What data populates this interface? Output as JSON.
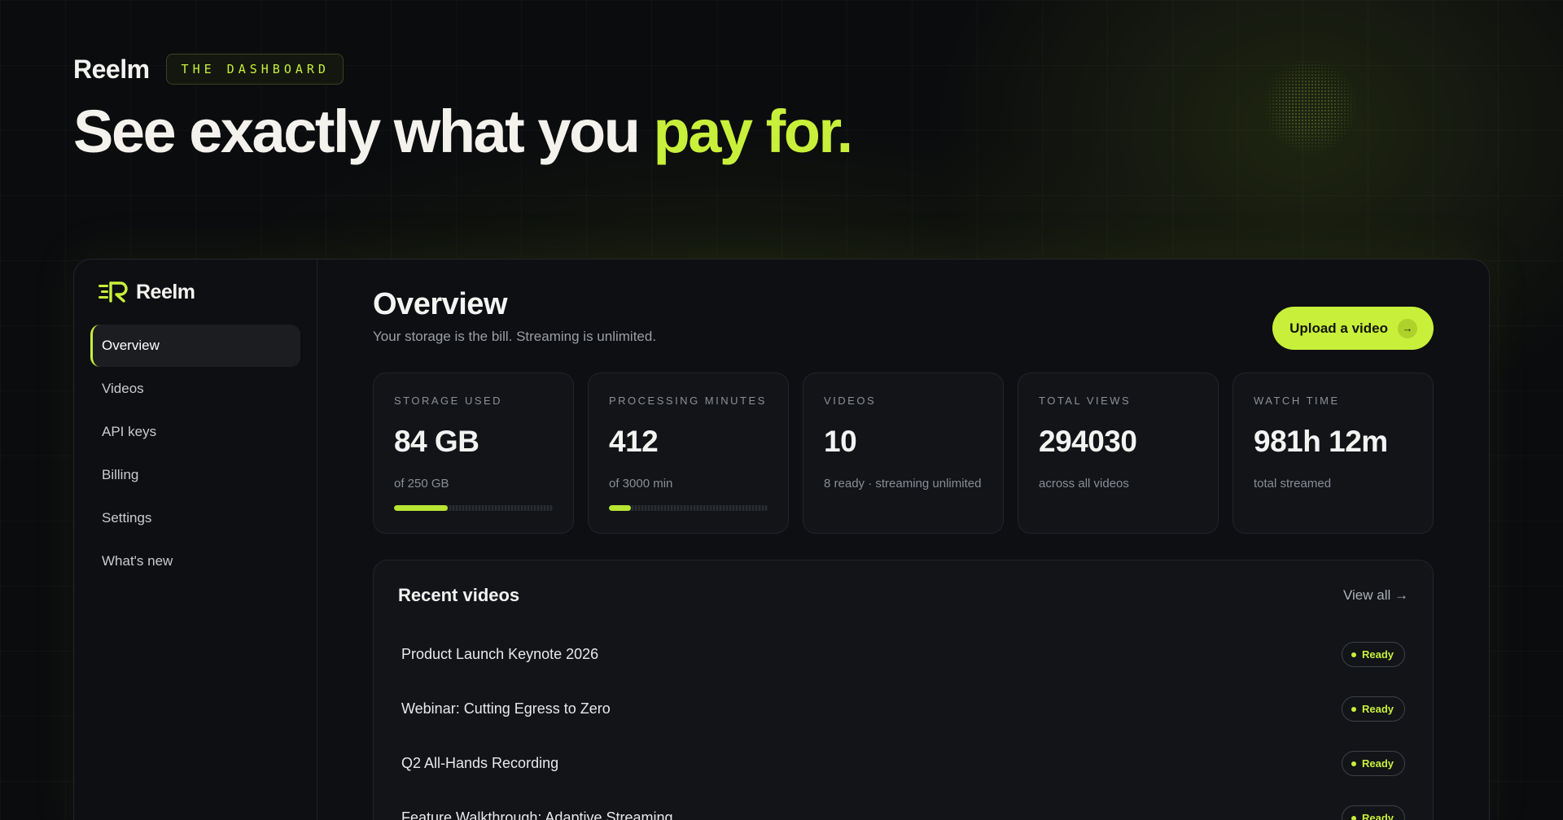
{
  "hero": {
    "brand": "Reelm",
    "pill": "THE DASHBOARD",
    "title_main": "See exactly what you",
    "title_accent": "pay for."
  },
  "sidebar": {
    "brand": "Reelm",
    "items": [
      {
        "label": "Overview",
        "active": true
      },
      {
        "label": "Videos"
      },
      {
        "label": "API keys"
      },
      {
        "label": "Billing"
      },
      {
        "label": "Settings"
      },
      {
        "label": "What's new"
      }
    ]
  },
  "main": {
    "title": "Overview",
    "subtitle": "Your storage is the bill. Streaming is unlimited.",
    "upload_label": "Upload a video",
    "upload_icon": "arrow-right-icon"
  },
  "stats": [
    {
      "label": "Storage used",
      "value": "84 GB",
      "note": "of 250 GB",
      "progress": 0.336
    },
    {
      "label": "Processing minutes",
      "value": "412",
      "note": "of 3000 min",
      "progress": 0.137
    },
    {
      "label": "Videos",
      "value": "10",
      "note": "8 ready · streaming unlimited"
    },
    {
      "label": "Total views",
      "value": "294030",
      "note": "across all videos"
    },
    {
      "label": "Watch time",
      "value": "981h 12m",
      "note": "total streamed"
    }
  ],
  "recent": {
    "title": "Recent videos",
    "view_all": "View all →",
    "videos": [
      {
        "title": "Product Launch Keynote 2026",
        "status": "Ready"
      },
      {
        "title": "Webinar: Cutting Egress to Zero",
        "status": "Ready"
      },
      {
        "title": "Q2 All-Hands Recording",
        "status": "Ready"
      },
      {
        "title": "Feature Walkthrough: Adaptive Streaming",
        "status": "Ready"
      }
    ]
  },
  "colors": {
    "accent": "#c8f03a",
    "background": "#0b0c0e",
    "card": "#121418"
  }
}
